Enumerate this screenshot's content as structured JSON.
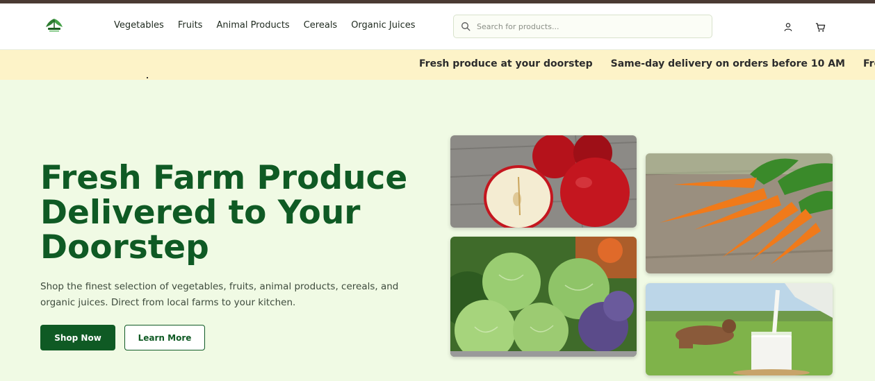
{
  "header": {
    "logo_icon": "leaf-logo-icon",
    "nav": [
      "Vegetables",
      "Fruits",
      "Animal Products",
      "Cereals",
      "Organic Juices"
    ],
    "search_placeholder": "Search for products...",
    "icons": [
      "user-icon",
      "cart-icon"
    ]
  },
  "ticker": {
    "items": [
      "Fresh produce at your doorstep",
      "Same-day delivery on orders before 10 AM",
      "Free delivery on orders over"
    ]
  },
  "hero": {
    "title": "Fresh Farm Produce Delivered to Your Doorstep",
    "subtitle": "Shop the finest selection of vegetables, fruits, animal products, cereals, and organic juices. Direct from local farms to your kitchen.",
    "primary_button": "Shop Now",
    "secondary_button": "Learn More"
  },
  "gallery": [
    "apples-image",
    "cabbage-image",
    "carrots-image",
    "milk-image"
  ],
  "colors": {
    "brand_green": "#0f5a24",
    "hero_background": "#f0fae4",
    "ticker_background": "#fdf3c8",
    "top_bar": "#4a3a33"
  }
}
